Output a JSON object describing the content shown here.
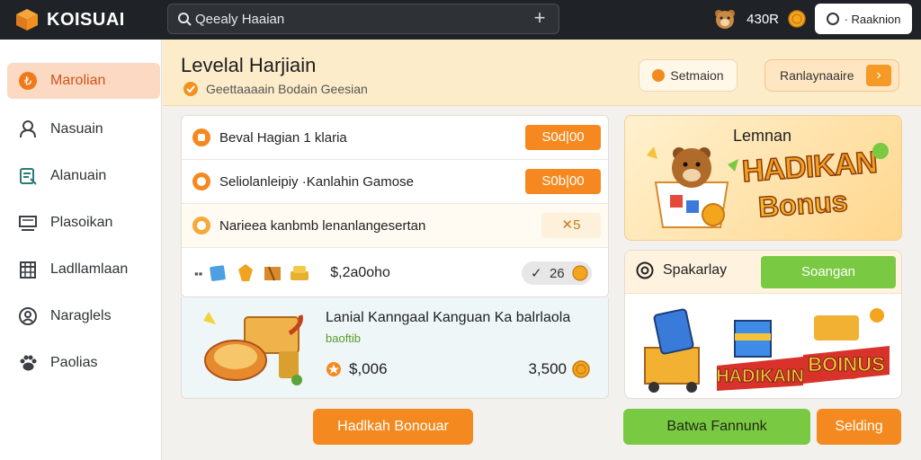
{
  "app": {
    "name": "KOISUAI"
  },
  "search": {
    "value": "Qeealy Haaian"
  },
  "topbar": {
    "coin_count": "430R",
    "status_label": "· Raaknion"
  },
  "sidebar": {
    "items": [
      {
        "label": "Marolian",
        "icon": "coin-icon",
        "active": true
      },
      {
        "label": "Nasuain",
        "icon": "people-icon"
      },
      {
        "label": "Alanuain",
        "icon": "note-icon"
      },
      {
        "label": "Plasoikan",
        "icon": "monitor-icon"
      },
      {
        "label": "Ladllamlaan",
        "icon": "calendar-icon"
      },
      {
        "label": "Naraglels",
        "icon": "user-icon"
      },
      {
        "label": "Paolias",
        "icon": "paw-icon"
      }
    ]
  },
  "header": {
    "title": "Levelal Harjiain",
    "subtitle": "Geettaaaain Bodain Geesian",
    "btn1": "Setmaion",
    "btn2": "Ranlaynaaire"
  },
  "rewards": {
    "rows": [
      {
        "label": "Beval Hagian 1 klaria",
        "value": "S0d|00"
      },
      {
        "label": "Seliolanleipiy  ·Kanlahin Gamose",
        "value": "S0b|00"
      },
      {
        "label": "Narieea kanbmb lenanlangesertan",
        "value": "✕5"
      }
    ],
    "items_price": "$,2a0oho",
    "items_count": "26",
    "items_prefix": "✓"
  },
  "promo": {
    "title": "Lanial Kanngaal Kanguan Ka balrlaola",
    "subtitle": "baoftib",
    "price": "$,006",
    "total": "3,500"
  },
  "banner": {
    "top": "Lemnan",
    "hadikan": "HADIKAN",
    "bonus": "Bonus"
  },
  "card2": {
    "title": "Spakarlay",
    "button": "Soangan",
    "art_hadikan": "HADIKAIN",
    "art_bonus": "BOINUS"
  },
  "buttons": {
    "bonus": "Hadlkah Bonouar",
    "green": "Batwa Fannunk",
    "setting": "Selding"
  },
  "colors": {
    "accent_orange": "#f48a1f",
    "accent_green": "#7ac943",
    "topbar": "#1f2226",
    "header_bg": "#fdecc9"
  }
}
